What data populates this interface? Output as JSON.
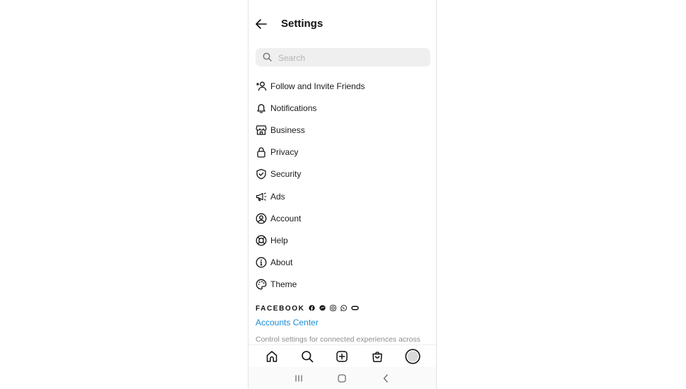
{
  "header": {
    "title": "Settings",
    "back_icon": "arrow-left-icon"
  },
  "search": {
    "placeholder": "Search",
    "value": ""
  },
  "menu": [
    {
      "label": "Follow and Invite Friends",
      "icon": "add-person-icon"
    },
    {
      "label": "Notifications",
      "icon": "bell-icon"
    },
    {
      "label": "Business",
      "icon": "storefront-icon"
    },
    {
      "label": "Privacy",
      "icon": "lock-icon"
    },
    {
      "label": "Security",
      "icon": "shield-check-icon"
    },
    {
      "label": "Ads",
      "icon": "megaphone-icon"
    },
    {
      "label": "Account",
      "icon": "person-circle-icon"
    },
    {
      "label": "Help",
      "icon": "lifebuoy-icon"
    },
    {
      "label": "About",
      "icon": "info-icon"
    },
    {
      "label": "Theme",
      "icon": "palette-icon"
    }
  ],
  "facebook": {
    "wordmark": "FACEBOOK",
    "apps": [
      "facebook-icon",
      "messenger-icon",
      "instagram-icon",
      "whatsapp-icon",
      "oculus-icon"
    ],
    "accounts_center": "Accounts Center",
    "description": "Control settings for connected experiences across"
  },
  "tabbar": [
    "home-icon",
    "search-icon",
    "create-icon",
    "shop-icon",
    "profile-avatar"
  ],
  "sysnav": [
    "recent-apps-icon",
    "home-button-icon",
    "back-icon"
  ],
  "colors": {
    "link": "#1a8bd6",
    "search_bg": "#efefef",
    "muted": "#8e8e8e"
  }
}
